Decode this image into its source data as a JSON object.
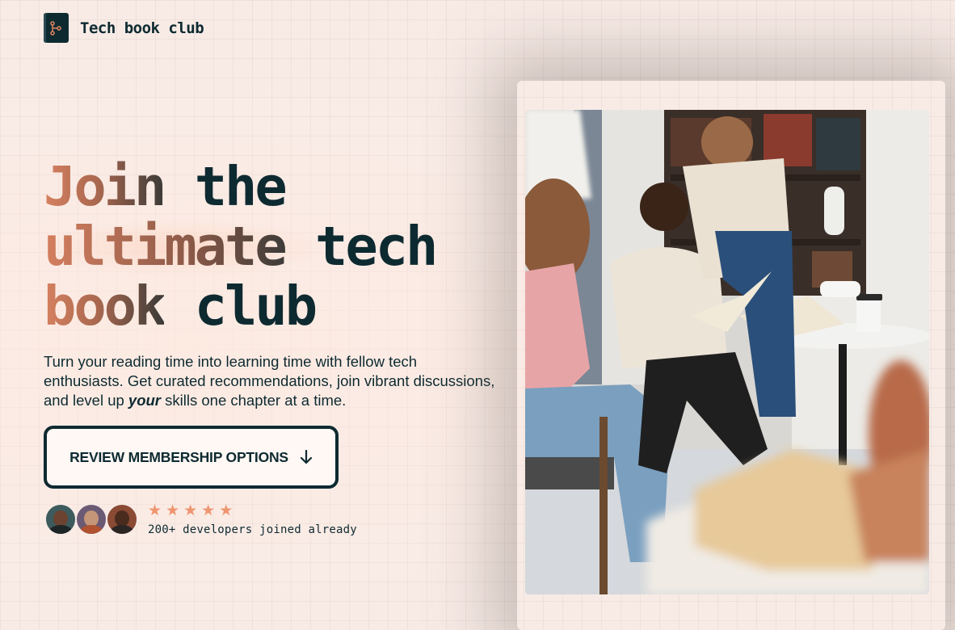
{
  "header": {
    "brand": "Tech book club",
    "logo_icon": "book-branch-icon"
  },
  "hero": {
    "headline": {
      "line1_gradient": "Join",
      "line1_dark": "the",
      "line2_gradient": "ultimate",
      "line2_dark": "tech",
      "line3_gradient": "book",
      "line3_dark": "club"
    },
    "description": {
      "before": "Turn your reading time into learning time with fellow tech enthusiasts. Get curated recommendations, join vibrant discussions, and level up ",
      "emphasis": "your",
      "after": " skills one chapter at a time."
    },
    "cta": {
      "label": "REVIEW MEMBERSHIP OPTIONS",
      "icon": "arrow-down-icon"
    },
    "social_proof": {
      "rating_stars": 5,
      "joined_text": "200+ developers joined already"
    },
    "image": {
      "description_icon": "book-club-photo"
    }
  },
  "colors": {
    "primary_dark": "#0e2a31",
    "accent_orange": "#d68160",
    "star": "#ef9570",
    "background": "#f8ebe6"
  }
}
